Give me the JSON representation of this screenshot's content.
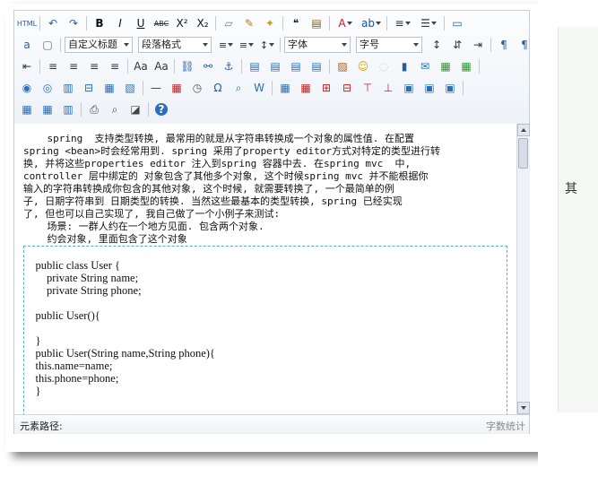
{
  "editor": {
    "toolbar": {
      "row1": [
        {
          "name": "source-html-button",
          "label": "HTML",
          "color": "#1b5fb8"
        },
        {
          "name": "undo-icon",
          "label": "↶",
          "color": "#2a5d9f"
        },
        {
          "name": "redo-icon",
          "label": "↷",
          "color": "#2a5d9f"
        },
        {
          "name": "bold-button",
          "label": "B",
          "color": "#111"
        },
        {
          "name": "italic-button",
          "label": "I",
          "color": "#111"
        },
        {
          "name": "underline-button",
          "label": "U",
          "color": "#111"
        },
        {
          "name": "strikethrough-button",
          "label": "ABC",
          "color": "#333"
        },
        {
          "name": "superscript-button",
          "label": "X²",
          "color": "#111"
        },
        {
          "name": "subscript-button",
          "label": "X₂",
          "color": "#111"
        },
        {
          "name": "eraser-icon",
          "label": "▱",
          "color": "#7a7a7a"
        },
        {
          "name": "format-painter-icon",
          "label": "✎",
          "color": "#b8741a"
        },
        {
          "name": "auto-format-icon",
          "label": "✦",
          "color": "#c9a017"
        },
        {
          "name": "blockquote-button",
          "label": "❝",
          "color": "#222"
        },
        {
          "name": "paste-plain-icon",
          "label": "▤",
          "color": "#7a5a2a"
        },
        {
          "name": "font-color-button",
          "label": "A",
          "color": "#c61c1c"
        },
        {
          "name": "background-color-button",
          "label": "ab",
          "color": "#1b4fa8"
        },
        {
          "name": "ordered-list-button",
          "label": "≡",
          "color": "#333"
        },
        {
          "name": "unordered-list-button",
          "label": "☰",
          "color": "#333"
        },
        {
          "name": "fullscreen-icon",
          "label": "▭",
          "color": "#2a5d9f"
        }
      ],
      "custom_title": "自定义标题",
      "paragraph_format": "段落格式",
      "font_family": "字体",
      "font_size": "字号",
      "row2_icons": [
        {
          "name": "direction-ltr-icon",
          "label": "a",
          "color": "#2a5d9f"
        },
        {
          "name": "new-document-icon",
          "label": "▢",
          "color": "#666"
        }
      ],
      "row2_tail": [
        {
          "name": "line-height-button",
          "label": "↕",
          "color": "#333"
        },
        {
          "name": "paragraph-spacing-button",
          "label": "⇵",
          "color": "#333"
        },
        {
          "name": "indent-button",
          "label": "⇥",
          "color": "#333"
        },
        {
          "name": "text-direction-ltr-button",
          "label": "¶",
          "color": "#2a5d9f"
        },
        {
          "name": "text-direction-rtl-button",
          "label": "¶",
          "color": "#2a5d9f"
        }
      ],
      "row3": [
        {
          "name": "indent-icon",
          "label": "⇤",
          "color": "#333"
        },
        {
          "name": "align-left-button",
          "label": "≡",
          "color": "#333"
        },
        {
          "name": "align-center-button",
          "label": "≡",
          "color": "#333"
        },
        {
          "name": "align-right-button",
          "label": "≡",
          "color": "#333"
        },
        {
          "name": "align-justify-button",
          "label": "≡",
          "color": "#333"
        },
        {
          "name": "uppercase-button",
          "label": "Aa",
          "color": "#333"
        },
        {
          "name": "lowercase-button",
          "label": "Aa",
          "color": "#333"
        },
        {
          "name": "link-icon",
          "label": "⛓",
          "color": "#2a5d9f"
        },
        {
          "name": "unlink-icon",
          "label": "⚯",
          "color": "#2a5d9f"
        },
        {
          "name": "anchor-icon",
          "label": "⚓",
          "color": "#2a5d9f"
        },
        {
          "name": "image-left-icon",
          "label": "▤",
          "color": "#2a6db8"
        },
        {
          "name": "image-none-icon",
          "label": "▤",
          "color": "#2a6db8"
        },
        {
          "name": "image-center-icon",
          "label": "▤",
          "color": "#2a6db8"
        },
        {
          "name": "image-right-icon",
          "label": "▤",
          "color": "#2a6db8"
        },
        {
          "name": "insert-image-icon",
          "label": "▨",
          "color": "#b05a1a"
        },
        {
          "name": "emoticon-icon",
          "label": "☺",
          "color": "#d9a400"
        },
        {
          "name": "scrawl-icon",
          "label": "◌",
          "color": "#cfcfcf"
        },
        {
          "name": "video-icon",
          "label": "▮",
          "color": "#2a5d9f"
        },
        {
          "name": "attachment-icon",
          "label": "✉",
          "color": "#2a6db8"
        },
        {
          "name": "map-icon",
          "label": "▦",
          "color": "#3a8a3a"
        },
        {
          "name": "google-map-icon",
          "label": "▦",
          "color": "#2a9a2a"
        }
      ],
      "row4": [
        {
          "name": "insert-frame-icon",
          "label": "◉",
          "color": "#2a6db8"
        },
        {
          "name": "code-icon",
          "label": "◎",
          "color": "#2a6db8"
        },
        {
          "name": "page-break-icon",
          "label": "▥",
          "color": "#2a6db8"
        },
        {
          "name": "page-break-alt-icon",
          "label": "⊟",
          "color": "#2a6db8"
        },
        {
          "name": "background-icon",
          "label": "▦",
          "color": "#2a6db8"
        },
        {
          "name": "template-icon",
          "label": "▧",
          "color": "#2a6db8"
        },
        {
          "name": "horizontal-rule-icon",
          "label": "—",
          "color": "#333"
        },
        {
          "name": "date-icon",
          "label": "▦",
          "color": "#c62020"
        },
        {
          "name": "time-icon",
          "label": "◷",
          "color": "#555"
        },
        {
          "name": "special-char-icon",
          "label": "Ω",
          "color": "#2a5d9f"
        },
        {
          "name": "search-replace-icon",
          "label": "⌕",
          "color": "#2a6db8"
        },
        {
          "name": "word-image-icon",
          "label": "W",
          "color": "#2a6db8"
        },
        {
          "name": "insert-table-icon",
          "label": "▦",
          "color": "#2a6db8"
        },
        {
          "name": "delete-table-icon",
          "label": "▦",
          "color": "#c62020"
        },
        {
          "name": "insert-row-icon",
          "label": "⊞",
          "color": "#c62020"
        },
        {
          "name": "delete-row-icon",
          "label": "⊟",
          "color": "#c62020"
        },
        {
          "name": "insert-col-icon",
          "label": "⊤",
          "color": "#c62020"
        },
        {
          "name": "delete-col-icon",
          "label": "⊥",
          "color": "#c62020"
        },
        {
          "name": "merge-cells-icon",
          "label": "▣",
          "color": "#2a6db8"
        },
        {
          "name": "merge-right-icon",
          "label": "▣",
          "color": "#2a6db8"
        },
        {
          "name": "merge-down-icon",
          "label": "▣",
          "color": "#2a6db8"
        }
      ],
      "row5": [
        {
          "name": "split-cells-icon",
          "label": "▦",
          "color": "#2a6db8"
        },
        {
          "name": "split-rows-icon",
          "label": "▦",
          "color": "#2a6db8"
        },
        {
          "name": "split-cols-icon",
          "label": "▥",
          "color": "#2a6db8"
        },
        {
          "name": "print-icon",
          "label": "⎙",
          "color": "#444"
        },
        {
          "name": "preview-icon",
          "label": "⌕",
          "color": "#444"
        },
        {
          "name": "search-icon",
          "label": "◪",
          "color": "#444"
        },
        {
          "name": "help-icon",
          "label": "?",
          "color": "#ffffff"
        }
      ]
    },
    "content": {
      "paragraphs": [
        "    spring  支持类型转换, 最常用的就是从字符串转换成一个对象的属性值. 在配置",
        "spring <bean>时会经常用到. spring 采用了property editor方式对特定的类型进行转",
        "换, 并将这些properties editor 注入到spring 容器中去. 在spring mvc  中,",
        "controller 层中绑定的 对象包含了其他多个对象, 这个时候spring mvc 并不能根据你",
        "输入的字符串转换成你包含的其他对象, 这个时候, 就需要转换了, 一个最简单的例",
        "子, 日期字符串到 日期类型的转换. 当然这些最基本的类型转换, spring 已经实现",
        "了, 但也可以自己实现了, 我自己做了一个小例子来测试:",
        "    场景: 一群人约在一个地方见面. 包含两个对象.",
        "    约会对象, 里面包含了这个对象"
      ],
      "code_lines": [
        "",
        "    public class User {",
        "        private String name;",
        "        private String phone;",
        "",
        "    public User(){",
        "",
        "    }",
        "    public User(String name,String phone){",
        "    this.name=name;",
        "    this.phone=phone;",
        "    }"
      ]
    },
    "status": {
      "element_path": "元素路径:",
      "word_count": "字数统计"
    }
  },
  "background": {
    "side_glyph": "其"
  }
}
